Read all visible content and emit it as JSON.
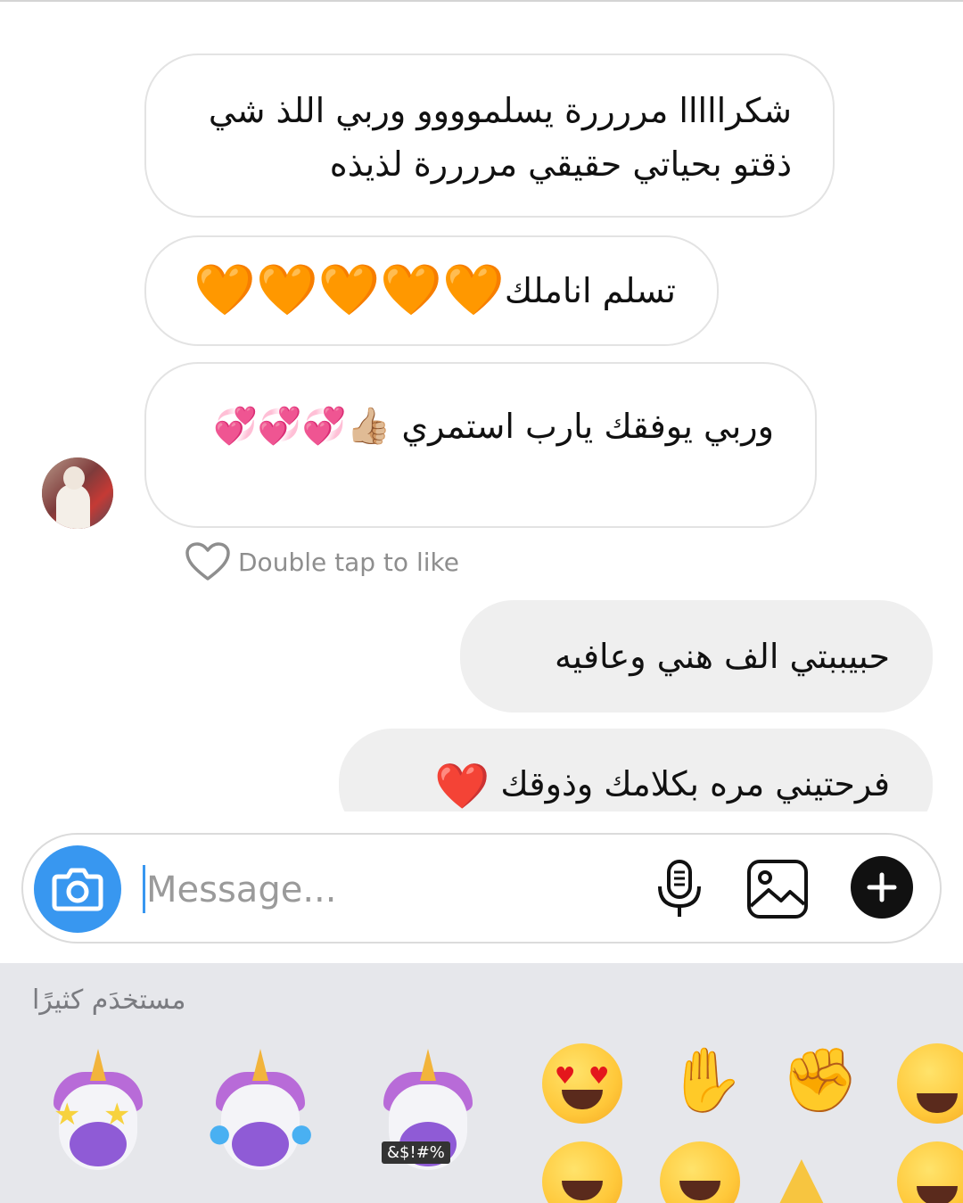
{
  "messages": [
    {
      "direction": "incoming",
      "text_line1": "شكرااااا مررررة يسلموووو وربي اللذ شي",
      "text_line2": "ذقتو بحياتي حقيقي مررررة لذيذه"
    },
    {
      "direction": "incoming",
      "text": "تسلم اناملك",
      "emojis": "🧡🧡🧡🧡🧡"
    },
    {
      "direction": "incoming",
      "text": "وربي يوفقك يارب استمري",
      "emojis": "👍🏼💞💞💞"
    },
    {
      "direction": "outgoing",
      "text": "حبيببتي الف هني وعافيه"
    },
    {
      "direction": "outgoing",
      "text": "فرحتيني مره بكلامك وذوقك",
      "emojis": "❤️"
    }
  ],
  "like_hint": "Double tap to like",
  "composer": {
    "placeholder": "Message..."
  },
  "emoji_panel": {
    "title": "مستخدَم كثيرًا",
    "memoji_tag": "&$!#%",
    "emojis": [
      "😍",
      "👌",
      "💪",
      "🤓",
      "😂",
      "😁",
      "👍",
      "😫"
    ]
  },
  "icons": {
    "camera": "camera-icon",
    "mic": "microphone-icon",
    "gallery": "gallery-icon",
    "plus": "plus-icon",
    "like": "heart-outline-icon"
  },
  "colors": {
    "accent": "#3897f0",
    "outgoing_bubble": "#efefef",
    "panel_bg": "#e6e7eb"
  }
}
